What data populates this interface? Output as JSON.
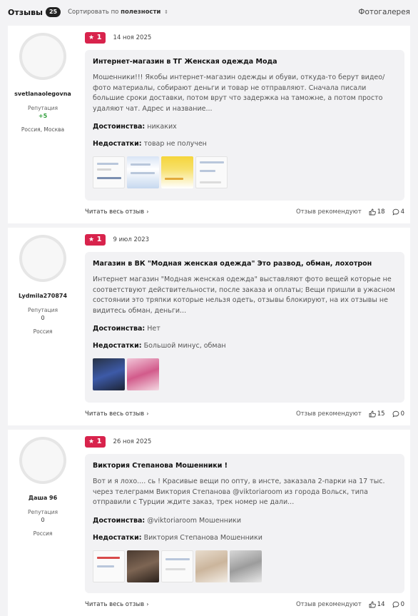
{
  "header": {
    "title": "Отзывы",
    "count": "25",
    "sort_prefix": "Сортировать по",
    "sort_value": "полезности",
    "sort_arrow": "⇕",
    "gallery": "Фотогалерея"
  },
  "reviews": [
    {
      "author": "svetlanaolegovna",
      "reputation_label": "Репутация",
      "reputation": "+5",
      "location": "Россия, Москва",
      "rating": "1",
      "date": "14 ноя 2025",
      "title": "Интернет-магазин в ТГ Женская одежда Мода",
      "text": "Мошенники!!! Якобы интернет-магазин одежды и обуви, откуда-то берут видео/фото материалы, собирают деньги и товар не отправляют. Сначала писали большие сроки доставки, потом врут что задержка на таможне, а потом просто удаляют чат. Адрес и название...",
      "pros_label": "Достоинства:",
      "pros": "никаких",
      "cons_label": "Недостатки:",
      "cons": "товар не получен",
      "read_all": "Читать весь отзыв",
      "recommend": "Отзыв рекомендуют",
      "likes": "18",
      "comments": "4"
    },
    {
      "author": "Lydmila270874",
      "reputation_label": "Репутация",
      "reputation": "0",
      "location": "Россия",
      "rating": "1",
      "date": "9 июл 2023",
      "title": "Магазин в ВК \"Модная женская одежда\" Это развод, обман, лохотрон",
      "text": "Интернет магазин \"Модная женская одежда\" выставляют фото вещей которые не соответствуют действительности, после заказа и оплаты; Вещи пришли в ужасном состоянии это тряпки которые нельзя одеть, отзывы блокируют, на их отзывы не видитесь обман, деньги...",
      "pros_label": "Достоинства:",
      "pros": "Нет",
      "cons_label": "Недостатки:",
      "cons": "Большой минус, обман",
      "read_all": "Читать весь отзыв",
      "recommend": "Отзыв рекомендуют",
      "likes": "15",
      "comments": "0"
    },
    {
      "author": "Даша 96",
      "reputation_label": "Репутация",
      "reputation": "0",
      "location": "Россия",
      "rating": "1",
      "date": "26 ноя 2025",
      "title": "Виктория Степанова Мошенники !",
      "text": "Вот и я лохо.... сь ! Красивые вещи по опту, в инсте, заказала 2-парки на 17 тыс. через телеграмм Виктория Степанова @viktoriaroom из города Вольск, типа отправили с Турции ждите заказ, трек номер не дали...",
      "pros_label": "Достоинства:",
      "pros": "@viktoriaroom Мошенники",
      "cons_label": "Недостатки:",
      "cons": "Виктория Степанова Мошенники",
      "read_all": "Читать весь отзыв",
      "recommend": "Отзыв рекомендуют",
      "likes": "14",
      "comments": "0"
    }
  ],
  "icons": {
    "star": "star-icon",
    "like": "thumbs-up-icon",
    "comment": "comment-icon",
    "chevron": "chevron-right-icon"
  },
  "colors": {
    "rating_badge": "#d8234c",
    "positive_reputation": "#2e9e3a"
  }
}
